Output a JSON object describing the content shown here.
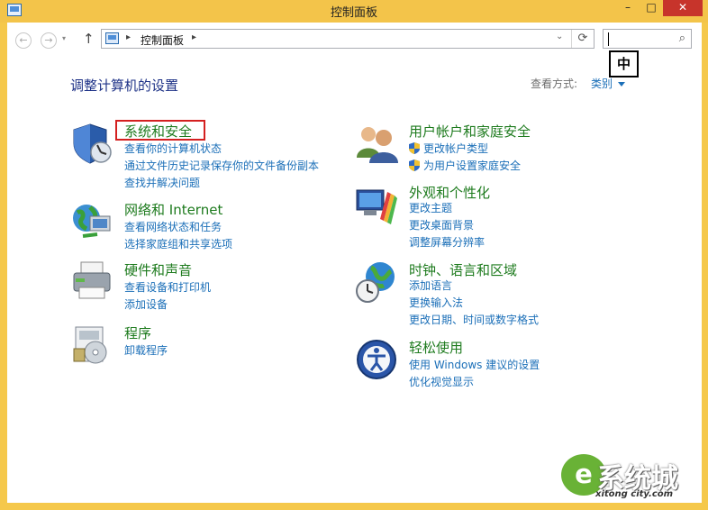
{
  "window": {
    "title": "控制面板",
    "minimize": "–",
    "maximize": "□",
    "close": "✕"
  },
  "nav": {
    "back": "←",
    "forward": "→",
    "recent": "▾",
    "up": "↑"
  },
  "address": {
    "separator": "▸",
    "crumb": "控制面板",
    "dropdown": "⌄",
    "refresh": "⟳"
  },
  "search": {
    "value": "",
    "icon": "⌕"
  },
  "ime": {
    "indicator": "中"
  },
  "page": {
    "title": "调整计算机的设置",
    "view_by_label": "查看方式:",
    "view_by_value": "类别"
  },
  "categories": [
    {
      "title": "系统和安全",
      "links": [
        "查看你的计算机状态",
        "通过文件历史记录保存你的文件备份副本",
        "查找并解决问题"
      ]
    },
    {
      "title": "网络和 Internet",
      "links": [
        "查看网络状态和任务",
        "选择家庭组和共享选项"
      ]
    },
    {
      "title": "硬件和声音",
      "links": [
        "查看设备和打印机",
        "添加设备"
      ]
    },
    {
      "title": "程序",
      "links": [
        "卸载程序"
      ]
    },
    {
      "title": "用户帐户和家庭安全",
      "links": [
        "更改帐户类型",
        "为用户设置家庭安全"
      ]
    },
    {
      "title": "外观和个性化",
      "links": [
        "更改主题",
        "更改桌面背景",
        "调整屏幕分辨率"
      ]
    },
    {
      "title": "时钟、语言和区域",
      "links": [
        "添加语言",
        "更换输入法",
        "更改日期、时间或数字格式"
      ]
    },
    {
      "title": "轻松使用",
      "links": [
        "使用 Windows 建议的设置",
        "优化视觉显示"
      ]
    }
  ],
  "watermark": {
    "text": "系统城",
    "sub": "xitong city.com"
  },
  "colors": {
    "titlebar": "#f3c44a",
    "category_title": "#1e7b1e",
    "link": "#1b6fb8",
    "highlight": "#d42020",
    "close_button": "#c7342b"
  }
}
